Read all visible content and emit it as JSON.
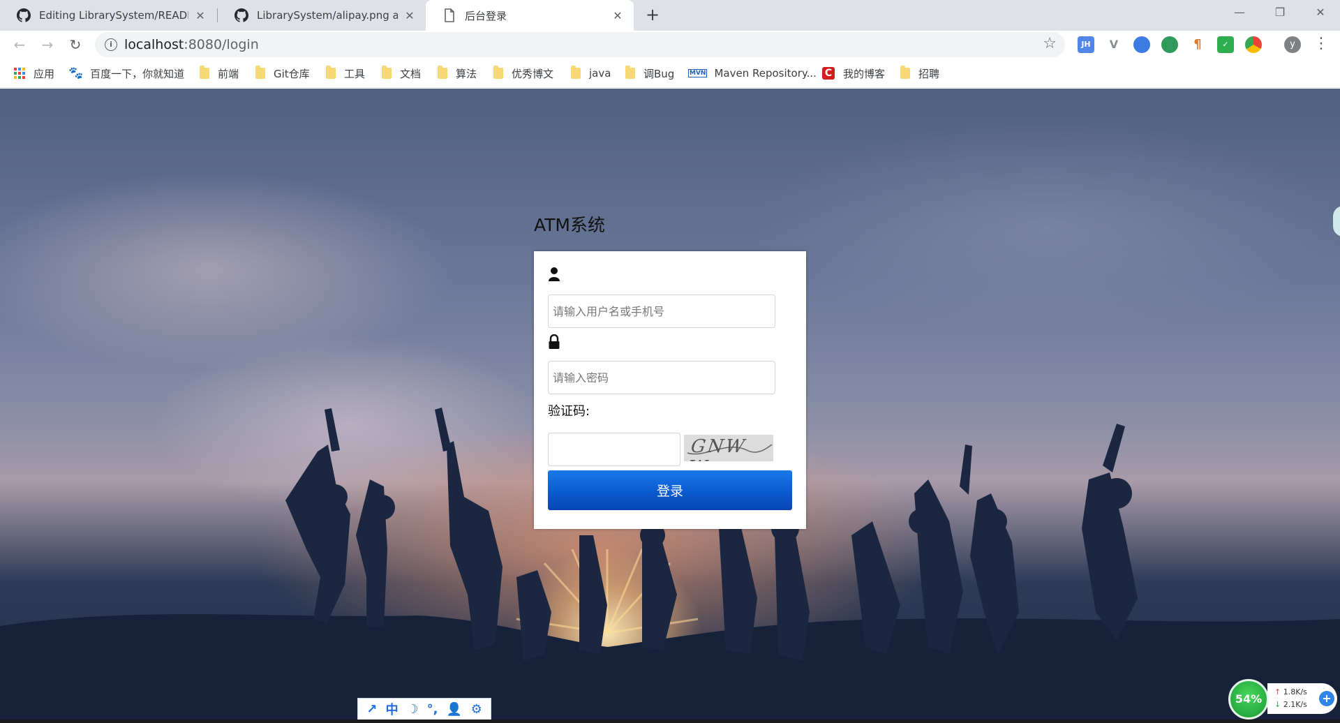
{
  "browser": {
    "tabs": [
      {
        "title": "Editing LibrarySystem/READM",
        "icon": "github-icon",
        "active": false
      },
      {
        "title": "LibrarySystem/alipay.png at m",
        "icon": "github-icon",
        "active": false
      },
      {
        "title": "后台登录",
        "icon": "page-icon",
        "active": true
      }
    ],
    "new_tab_label": "+",
    "url_host": "localhost",
    "url_rest": ":8080/login",
    "profile_initial": "y"
  },
  "bookmarks": [
    {
      "label": "应用",
      "icon": "apps-grid-icon"
    },
    {
      "label": "百度一下，你就知道",
      "icon": "baidu-icon"
    },
    {
      "label": "前端",
      "icon": "folder-icon"
    },
    {
      "label": "Git仓库",
      "icon": "folder-icon"
    },
    {
      "label": "工具",
      "icon": "folder-icon"
    },
    {
      "label": "文档",
      "icon": "folder-icon"
    },
    {
      "label": "算法",
      "icon": "folder-icon"
    },
    {
      "label": "优秀博文",
      "icon": "folder-icon"
    },
    {
      "label": "java",
      "icon": "folder-icon"
    },
    {
      "label": "调Bug",
      "icon": "folder-icon"
    },
    {
      "label": "Maven Repository...",
      "icon": "mvn-icon"
    },
    {
      "label": "我的博客",
      "icon": "csdn-icon"
    },
    {
      "label": "招聘",
      "icon": "folder-icon"
    }
  ],
  "extensions": [
    {
      "label": "JH",
      "color": "#4f86e8"
    },
    {
      "label": "V",
      "color": "#8a8f95"
    },
    {
      "label": "",
      "color": "#3c7be0"
    },
    {
      "label": "",
      "color": "#2f9a5a"
    },
    {
      "label": "¶",
      "color": "#e07a2a"
    },
    {
      "label": "✓",
      "color": "#2fae4e"
    },
    {
      "label": "",
      "color": "#e84a3c"
    }
  ],
  "login": {
    "title": "ATM系统",
    "username_placeholder": "请输入用户名或手机号",
    "password_placeholder": "请输入密码",
    "captcha_label": "验证码:",
    "captcha_value": "",
    "captcha_text": "GNW W",
    "submit_label": "登录"
  },
  "ime_bar": [
    "↗",
    "中",
    "☽",
    "°,",
    "👤",
    "⚙"
  ],
  "net_monitor": {
    "percent": "54%",
    "up": "1.8K/s",
    "down": "2.1K/s",
    "plus": "+"
  }
}
